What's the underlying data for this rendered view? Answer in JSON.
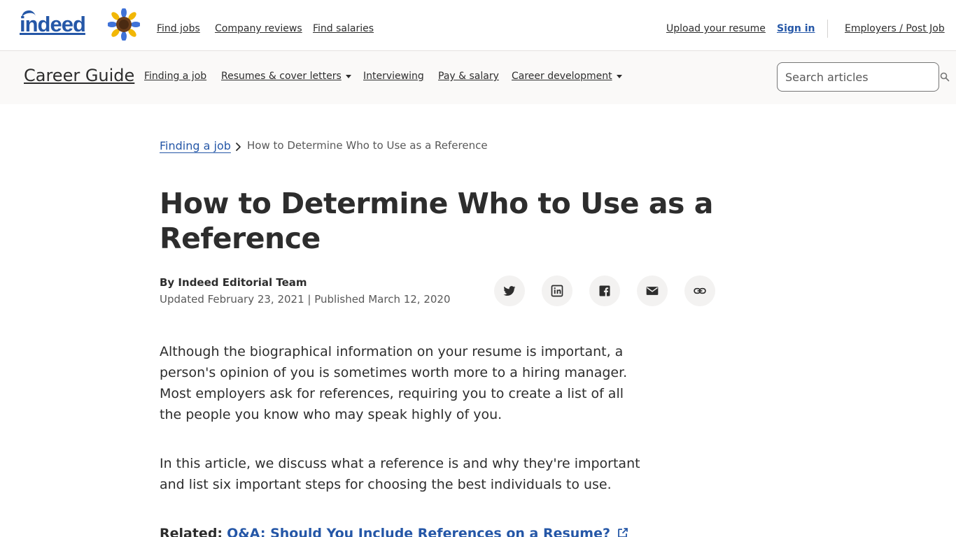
{
  "header": {
    "logo_text": "indeed",
    "nav": [
      "Find jobs",
      "Company reviews",
      "Find salaries"
    ],
    "upload_resume": "Upload your resume",
    "sign_in": "Sign in",
    "employers": "Employers / Post Job",
    "icons": {
      "brand_mark": "sunflower-icon"
    }
  },
  "guide": {
    "title": "Career Guide",
    "links": [
      "Finding a job",
      "Resumes & cover letters",
      "Interviewing",
      "Pay & salary",
      "Career development"
    ],
    "search_placeholder": "Search articles",
    "search_icon": "search-icon"
  },
  "breadcrumb": {
    "parent": "Finding a job",
    "current": "How to Determine Who to Use as a Reference"
  },
  "article": {
    "title": "How to Determine Who to Use as a Reference",
    "author": "By Indeed Editorial Team",
    "dates": "Updated February 23, 2021 | Published March 12, 2020",
    "share_icons": [
      "twitter-icon",
      "linkedin-icon",
      "facebook-icon",
      "email-icon",
      "link-icon"
    ],
    "paragraphs": [
      "Although the biographical information on your resume is important, a person's opinion of you is sometimes worth more to a hiring manager. Most employers ask for references, requiring you to create a list of all the people you know who may speak highly of you.",
      "In this article, we discuss what a reference is and why they're important and list six important steps for choosing the best individuals to use."
    ],
    "related_label": "Related:",
    "related_link": "Q&A: Should You Include References on a Resume?"
  },
  "colors": {
    "brand_blue": "#2557a7",
    "text": "#2d2d2d",
    "muted": "#595959",
    "guide_bg": "#faf9f8",
    "share_bg": "#f3f2f1"
  }
}
